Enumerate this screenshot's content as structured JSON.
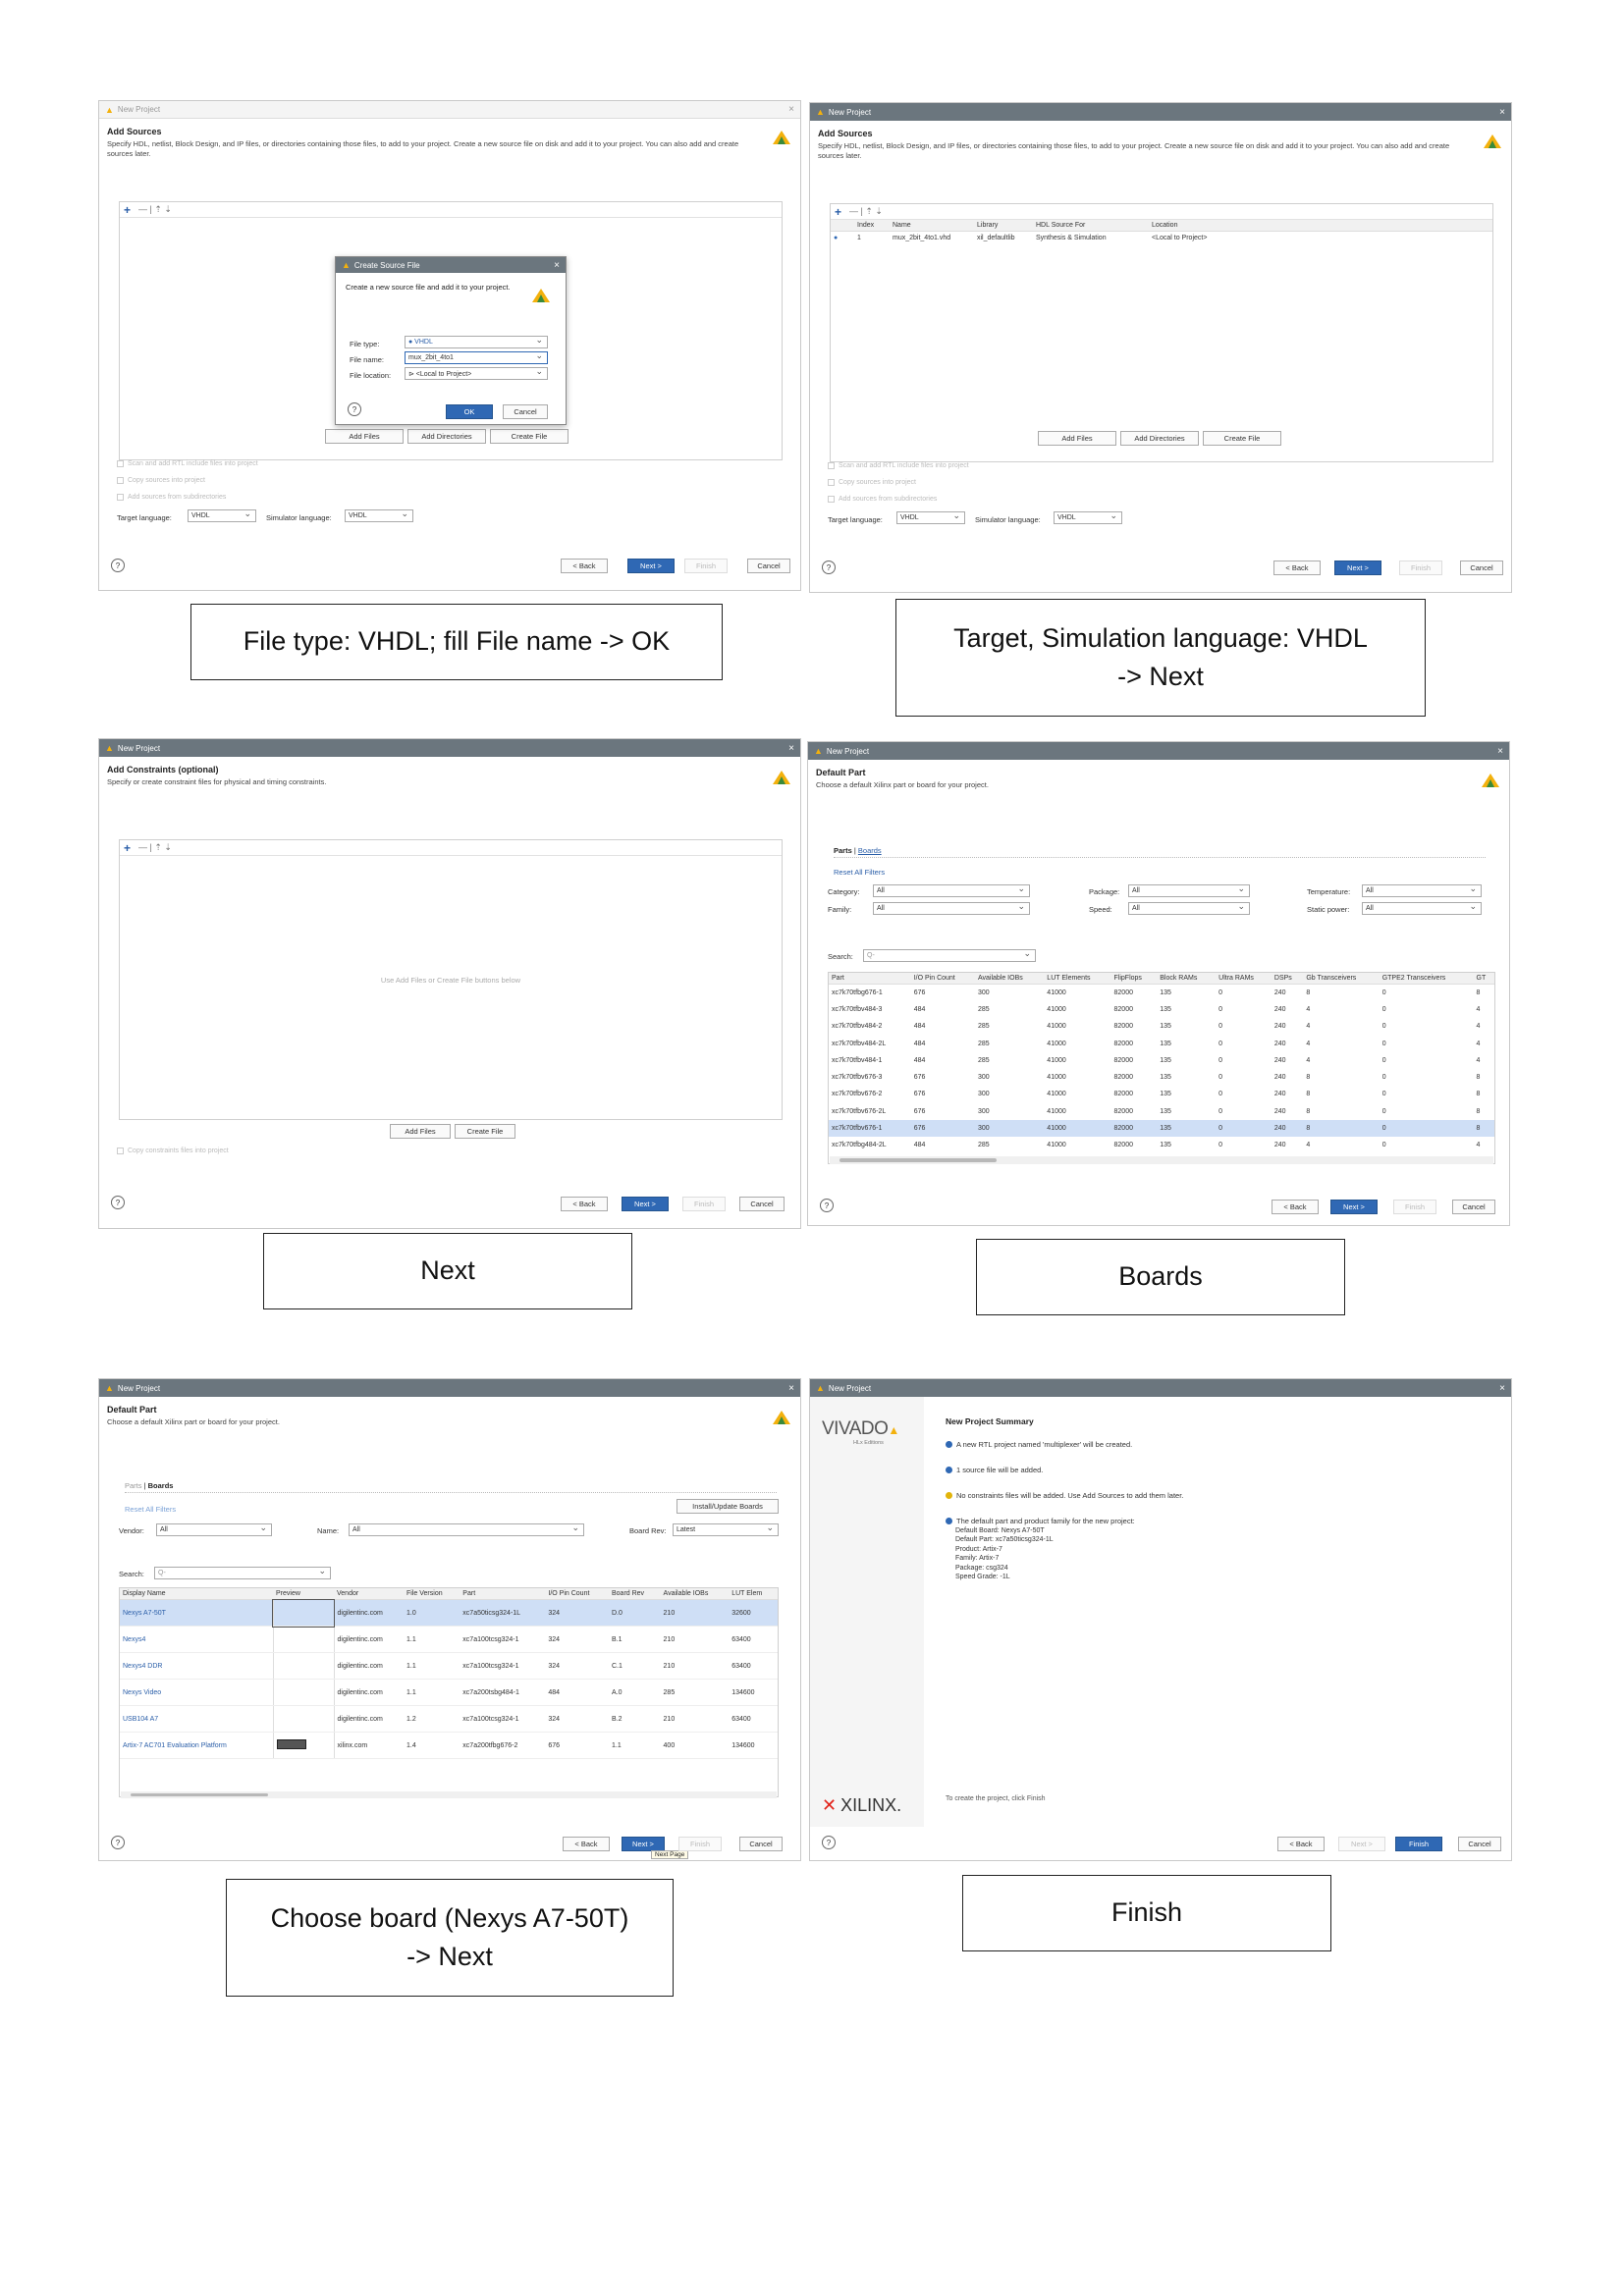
{
  "colors": {
    "accent": "#2f68b4",
    "titlebar": "#6b767e",
    "selected_row": "#cfdff6",
    "warning_dot": "#e2b40b",
    "info_dot": "#2f68b4",
    "xilinx_red": "#e2231a"
  },
  "icons": {
    "logo": "vivado-leaf-icon",
    "help": "help-icon",
    "close": "close-icon",
    "add": "plus-icon"
  },
  "common": {
    "window_title": "New Project",
    "close": "×",
    "help": "?",
    "back": "< Back",
    "next": "Next >",
    "finish": "Finish",
    "cancel": "Cancel",
    "add": "+",
    "tools_rest": "—  |  ⇡  ⇣"
  },
  "s1": {
    "title": "Add Sources",
    "desc": "Specify HDL, netlist, Block Design, and IP files, or directories containing those files, to add to your project. Create a new source file on disk and add it to your project. You can also add and create sources later.",
    "buttons": [
      "Add Files",
      "Add Directories",
      "Create File"
    ],
    "options": [
      "Scan and add RTL include files into project",
      "Copy sources into project",
      "Add sources from subdirectories"
    ],
    "target_label": "Target language:",
    "target_value": "VHDL",
    "sim_label": "Simulator language:",
    "sim_value": "VHDL",
    "dialog": {
      "title": "Create Source File",
      "desc": "Create a new source file and add it to your project.",
      "type_label": "File type:",
      "type_value": "● VHDL",
      "name_label": "File name:",
      "name_value": "mux_2bit_4to1",
      "loc_label": "File location:",
      "loc_value": "⊳ <Local to Project>",
      "ok": "OK",
      "cancel": "Cancel"
    },
    "caption": "File type: VHDL; fill File name -> OK"
  },
  "s2": {
    "title": "Add Sources",
    "desc": "Specify HDL, netlist, Block Design, and IP files, or directories containing those files, to add to your project. Create a new source file on disk and add it to your project. You can also add and create sources later.",
    "table_headers": [
      "",
      "Index",
      "Name",
      "Library",
      "HDL Source For",
      "Location"
    ],
    "table_rows": [
      [
        "●",
        "1",
        "mux_2bit_4to1.vhd",
        "xil_defaultlib",
        "Synthesis & Simulation",
        "<Local to Project>"
      ]
    ],
    "buttons": [
      "Add Files",
      "Add Directories",
      "Create File"
    ],
    "options": [
      "Scan and add RTL include files into project",
      "Copy sources into project",
      "Add sources from subdirectories"
    ],
    "target_label": "Target language:",
    "target_value": "VHDL",
    "sim_label": "Simulator language:",
    "sim_value": "VHDL",
    "caption_line1": "Target, Simulation  language: VHDL",
    "caption_line2": "-> Next"
  },
  "s3": {
    "title": "Add Constraints (optional)",
    "desc": "Specify or create constraint files for physical and timing constraints.",
    "empty": "Use Add Files or Create File buttons below",
    "buttons": [
      "Add Files",
      "Create File"
    ],
    "option": "Copy constraints files into project",
    "caption": "Next"
  },
  "s4": {
    "title": "Default Part",
    "desc": "Choose a default Xilinx part or board for your project.",
    "tab_parts": "Parts",
    "tab_boards": "Boards",
    "reset": "Reset All Filters",
    "category_label": "Category:",
    "category_value": "All",
    "family_label": "Family:",
    "family_value": "All",
    "package_label": "Package:",
    "package_value": "All",
    "speed_label": "Speed:",
    "speed_value": "All",
    "temp_label": "Temperature:",
    "temp_value": "All",
    "power_label": "Static power:",
    "power_value": "All",
    "search_label": "Search:",
    "search_value": "Q-",
    "headers": [
      "Part",
      "I/O Pin Count",
      "Available IOBs",
      "LUT Elements",
      "FlipFlops",
      "Block RAMs",
      "Ultra RAMs",
      "DSPs",
      "Gb Transceivers",
      "GTPE2 Transceivers",
      "GT"
    ],
    "rows": [
      [
        "xc7k70tfbg676-1",
        "676",
        "300",
        "41000",
        "82000",
        "135",
        "0",
        "240",
        "8",
        "0",
        "8"
      ],
      [
        "xc7k70tfbv484-3",
        "484",
        "285",
        "41000",
        "82000",
        "135",
        "0",
        "240",
        "4",
        "0",
        "4"
      ],
      [
        "xc7k70tfbv484-2",
        "484",
        "285",
        "41000",
        "82000",
        "135",
        "0",
        "240",
        "4",
        "0",
        "4"
      ],
      [
        "xc7k70tfbv484-2L",
        "484",
        "285",
        "41000",
        "82000",
        "135",
        "0",
        "240",
        "4",
        "0",
        "4"
      ],
      [
        "xc7k70tfbv484-1",
        "484",
        "285",
        "41000",
        "82000",
        "135",
        "0",
        "240",
        "4",
        "0",
        "4"
      ],
      [
        "xc7k70tfbv676-3",
        "676",
        "300",
        "41000",
        "82000",
        "135",
        "0",
        "240",
        "8",
        "0",
        "8"
      ],
      [
        "xc7k70tfbv676-2",
        "676",
        "300",
        "41000",
        "82000",
        "135",
        "0",
        "240",
        "8",
        "0",
        "8"
      ],
      [
        "xc7k70tfbv676-2L",
        "676",
        "300",
        "41000",
        "82000",
        "135",
        "0",
        "240",
        "8",
        "0",
        "8"
      ],
      [
        "xc7k70tfbv676-1",
        "676",
        "300",
        "41000",
        "82000",
        "135",
        "0",
        "240",
        "8",
        "0",
        "8"
      ],
      [
        "xc7k70tfbg484-2L",
        "484",
        "285",
        "41000",
        "82000",
        "135",
        "0",
        "240",
        "4",
        "0",
        "4"
      ]
    ],
    "selected_index": 8,
    "caption": "Boards"
  },
  "s5": {
    "title": "Default Part",
    "desc": "Choose a default Xilinx part or board for your project.",
    "tab_parts": "Parts",
    "tab_boards": "Boards",
    "reset": "Reset All Filters",
    "install": "Install/Update Boards",
    "vendor_label": "Vendor:",
    "vendor_value": "All",
    "name_label": "Name:",
    "name_value": "All",
    "rev_label": "Board Rev:",
    "rev_value": "Latest",
    "search_label": "Search:",
    "search_value": "Q-",
    "headers": [
      "Display Name",
      "Preview",
      "Vendor",
      "File Version",
      "Part",
      "I/O Pin Count",
      "Board Rev",
      "Available IOBs",
      "LUT Elem"
    ],
    "rows": [
      [
        "Nexys A7-50T",
        "",
        "digilentinc.com",
        "1.0",
        "xc7a50ticsg324-1L",
        "324",
        "D.0",
        "210",
        "32600"
      ],
      [
        "Nexys4",
        "",
        "digilentinc.com",
        "1.1",
        "xc7a100tcsg324-1",
        "324",
        "B.1",
        "210",
        "63400"
      ],
      [
        "Nexys4 DDR",
        "",
        "digilentinc.com",
        "1.1",
        "xc7a100tcsg324-1",
        "324",
        "C.1",
        "210",
        "63400"
      ],
      [
        "Nexys Video",
        "",
        "digilentinc.com",
        "1.1",
        "xc7a200tsbg484-1",
        "484",
        "A.0",
        "285",
        "134600"
      ],
      [
        "USB104 A7",
        "",
        "digilentinc.com",
        "1.2",
        "xc7a100tcsg324-1",
        "324",
        "B.2",
        "210",
        "63400"
      ],
      [
        "Artix-7 AC701 Evaluation Platform",
        "",
        "xilinx.com",
        "1.4",
        "xc7a200tfbg676-2",
        "676",
        "1.1",
        "400",
        "134600"
      ]
    ],
    "tooltip": "Next Page",
    "caption_line1": "Choose board (Nexys A7-50T)",
    "caption_line2": "-> Next"
  },
  "s6": {
    "brand": "VIVADO",
    "brand_sub": "HLx Editions",
    "xilinx": "XILINX.",
    "title": "New Project Summary",
    "lines": [
      {
        "icon": "info",
        "text": "A new RTL project named 'multiplexer' will be created."
      },
      {
        "icon": "info",
        "text": "1 source file will be added."
      },
      {
        "icon": "warning",
        "text": "No constraints files will be added. Use Add Sources to add them later."
      },
      {
        "icon": "info",
        "text": "The default part and product family for the new project:"
      }
    ],
    "details": [
      "Default Board: Nexys A7-50T",
      "Default Part: xc7a50ticsg324-1L",
      "Product: Artix-7",
      "Family: Artix-7",
      "Package: csg324",
      "Speed Grade: -1L"
    ],
    "footer": "To create the project, click Finish",
    "caption": "Finish"
  }
}
